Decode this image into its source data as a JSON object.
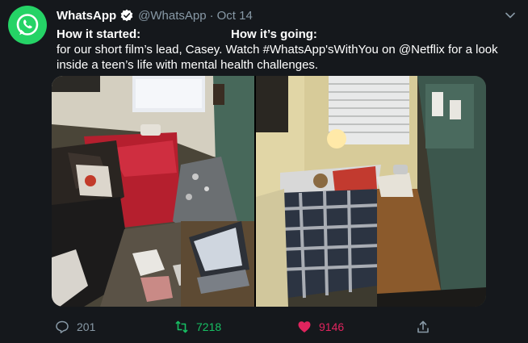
{
  "tweet": {
    "author_name": "WhatsApp",
    "handle": "@WhatsApp",
    "separator": "·",
    "date": "Oct 14",
    "started_label": "How it started:",
    "going_label": "How it’s going:",
    "body": "for our short film’s lead, Casey. Watch #WhatsApp'sWithYou on @Netflix for a look inside a teen’s life with mental health challenges."
  },
  "media": {
    "left_photo": "messy-bedroom-photo",
    "right_photo": "tidy-bedroom-photo"
  },
  "actions": {
    "replies": "201",
    "retweets": "7218",
    "likes": "9146"
  },
  "colors": {
    "background": "#15181c",
    "brand_green": "#25d366",
    "retweet_green": "#17bf63",
    "like_red": "#e0245e",
    "muted": "#8899a6",
    "verified_white": "#ffffff"
  }
}
